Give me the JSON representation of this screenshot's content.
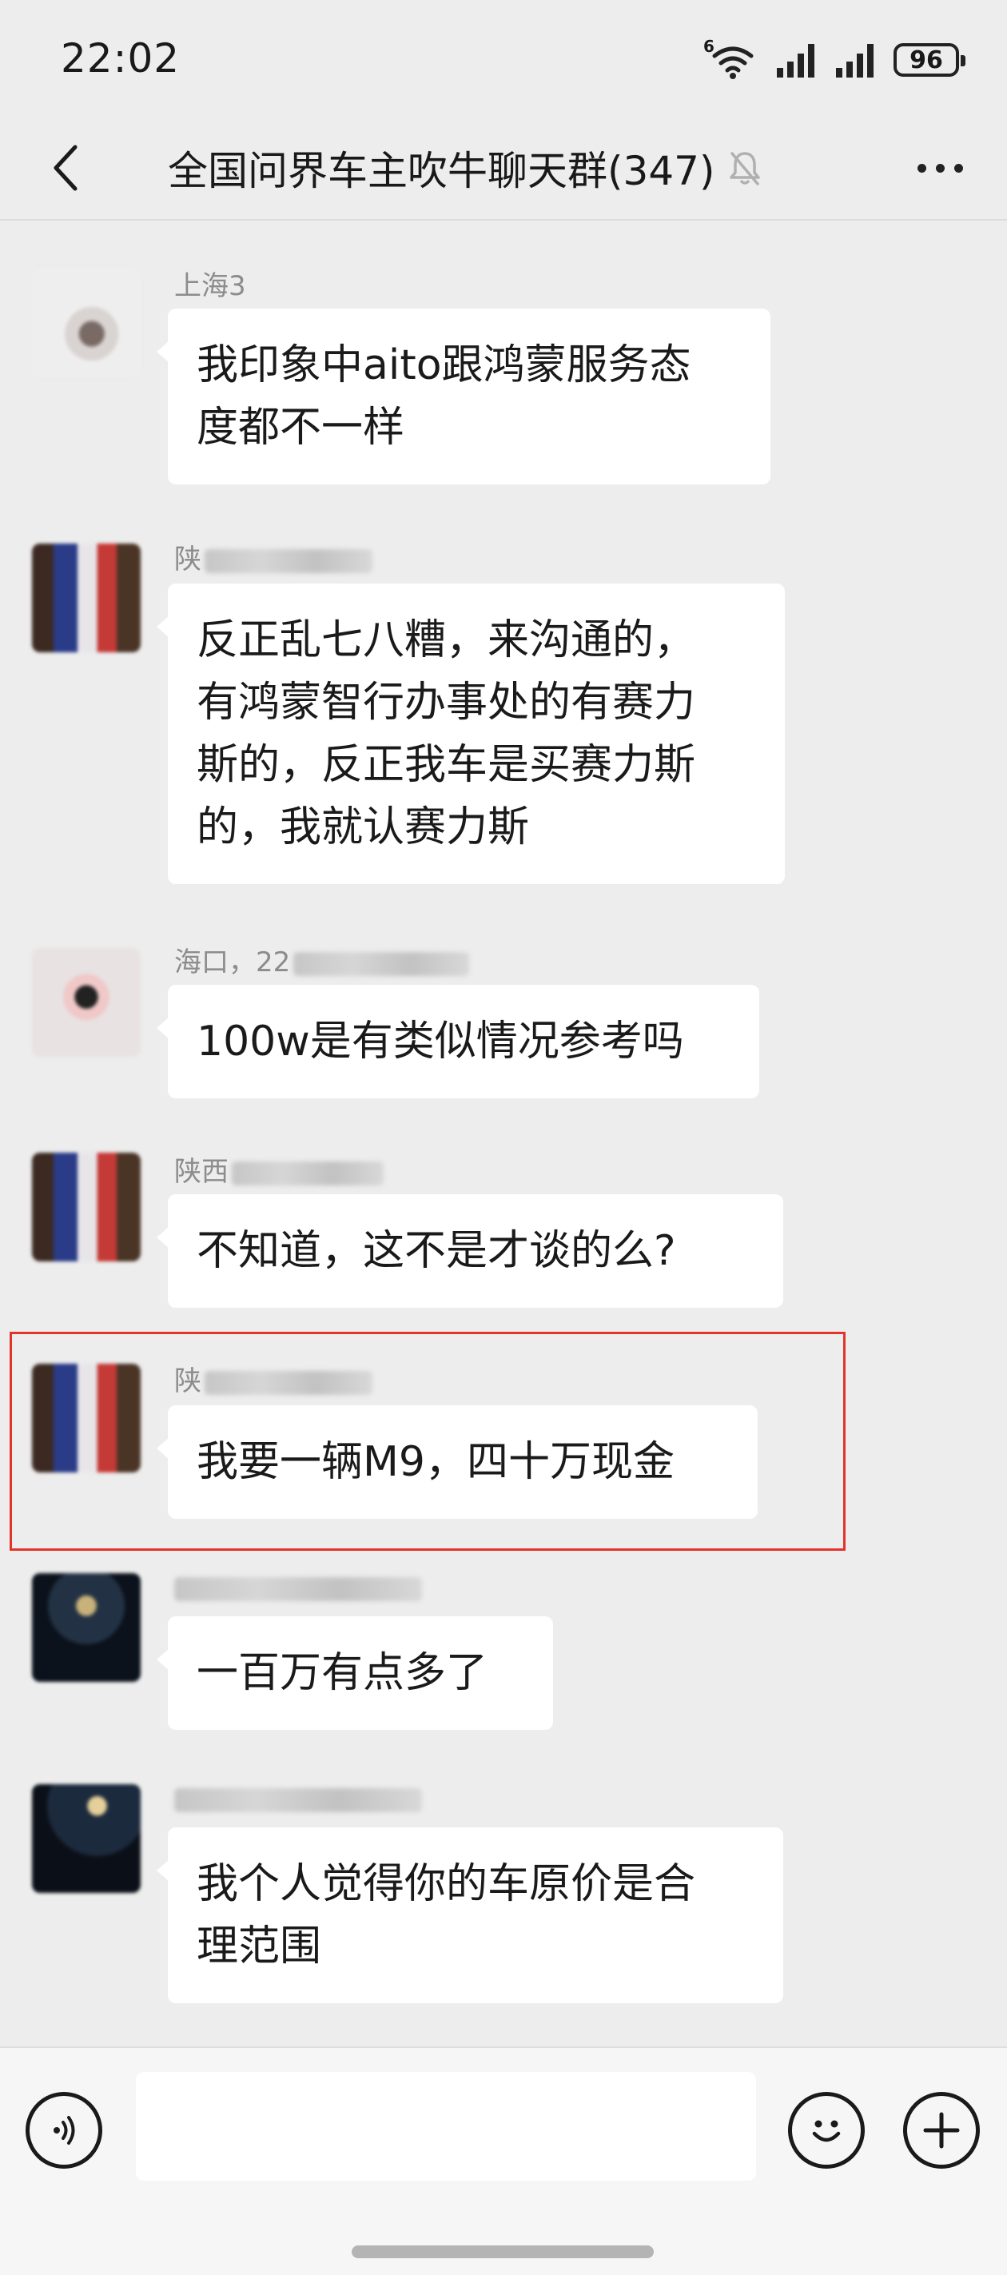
{
  "status_bar": {
    "time": "22:02",
    "wifi_label": "6",
    "battery": "96",
    "icons": [
      "wifi-icon",
      "signal-icon",
      "signal-icon",
      "battery-icon"
    ]
  },
  "nav": {
    "title": "全国问界车主吹牛聊天群(347)",
    "icons": [
      "back-icon",
      "mute-bell-icon",
      "more-icon"
    ]
  },
  "messages": [
    {
      "sender": "上海3",
      "text": "我印象中aito跟鸿蒙服务态\n度都不一样"
    },
    {
      "sender": "陕",
      "text": "反正乱七八糟，来沟通的，\n有鸿蒙智行办事处的有赛力\n斯的，反正我车是买赛力斯\n的，我就认赛力斯"
    },
    {
      "sender": "海口，22",
      "text": "100w是有类似情况参考吗"
    },
    {
      "sender": "陕西",
      "text": "不知道，这不是才谈的么?"
    },
    {
      "sender": "陕",
      "text": "我要一辆M9，四十万现金"
    },
    {
      "sender": "",
      "text": "一百万有点多了"
    },
    {
      "sender": "",
      "text": "我个人觉得你的车原价是合\n理范围"
    }
  ],
  "input_bar": {
    "placeholder": "",
    "icons": [
      "voice-icon",
      "emoji-icon",
      "plus-icon"
    ]
  }
}
